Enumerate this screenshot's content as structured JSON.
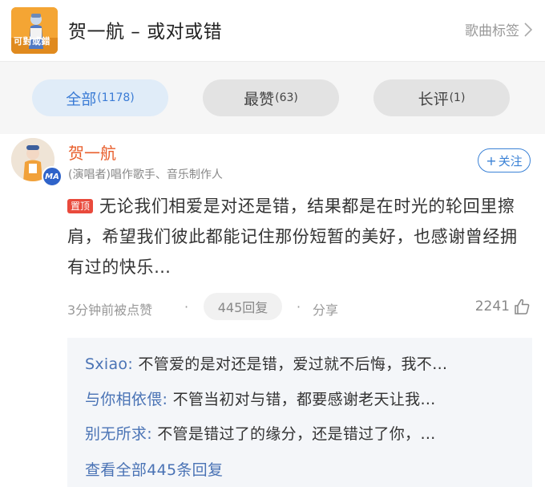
{
  "header": {
    "cover_text": "可對或錯",
    "title": "贺一航 – 或对或错",
    "song_tag_label": "歌曲标签"
  },
  "filters": [
    {
      "label": "全部",
      "count": "(1178)",
      "active": true
    },
    {
      "label": "最赞",
      "count": "(63)",
      "active": false
    },
    {
      "label": "长评",
      "count": "(1)",
      "active": false
    }
  ],
  "comment": {
    "user_name": "贺一航",
    "user_role": "(演唱者)唱作歌手、音乐制作人",
    "follow_label": "关注",
    "pin_label": "置顶",
    "text": "无论我们相爱是对还是错，结果都是在时光的轮回里擦肩，希望我们彼此都能记住那份短暂的美好，也感谢曾经拥有过的快乐…",
    "time": "3分钟前被点赞",
    "reply_count_label": "445回复",
    "share_label": "分享",
    "like_count": "2241"
  },
  "replies": {
    "items": [
      {
        "user": "Sxiao",
        "text": "不管爱的是对还是错，爱过就不后悔，我不…"
      },
      {
        "user": "与你相依偎",
        "text": "不管当初对与错，都要感谢老天让我…"
      },
      {
        "user": "别无所求",
        "text": "不管是错过了的缘分，还是错过了你，…"
      }
    ],
    "view_all_label": "查看全部445条回复"
  },
  "colors": {
    "accent_blue": "#3b82d6",
    "name_orange": "#e85e2b",
    "pin_red": "#e94a3c",
    "reply_user_blue": "#4a73b5"
  }
}
